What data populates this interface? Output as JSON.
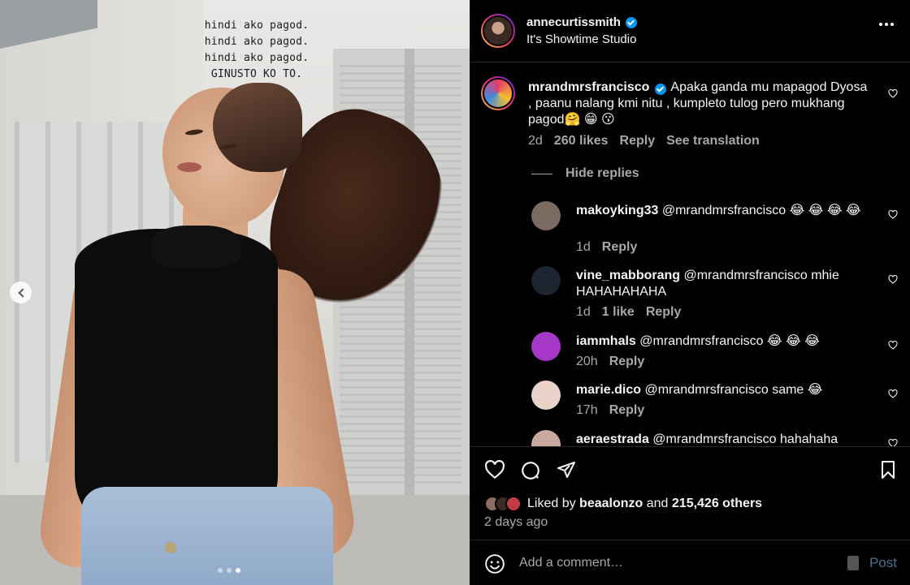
{
  "media": {
    "overlay_lines": [
      "hindi ako pagod.",
      "hindi ako pagod.",
      "hindi ako pagod.",
      "GINUSTO KO TO."
    ],
    "carousel": {
      "total": 3,
      "active": 3
    }
  },
  "header": {
    "username": "annecurtissmith",
    "location": "It's Showtime Studio",
    "verified": true
  },
  "main_comment": {
    "username": "mrandmrsfrancisco",
    "text": "Apaka ganda mu mapagod Dyosa , paanu nalang kmi nitu , kumpleto tulog pero mukhang pagod🤗 😁 😗",
    "time": "2d",
    "likes": "260 likes",
    "reply_label": "Reply",
    "translate_label": "See translation"
  },
  "hide_replies_label": "Hide replies",
  "replies": [
    {
      "username": "makoyking33",
      "text": "@mrandmrsfrancisco 😂 😂 😂 😂",
      "time": "1d",
      "likes": "",
      "reply_label": "Reply",
      "avatar_color": "#7a6a62"
    },
    {
      "username": "vine_mabborang",
      "text": "@mrandmrsfrancisco mhie HAHAHAHAHA",
      "time": "1d",
      "likes": "1 like",
      "reply_label": "Reply",
      "avatar_color": "#1c2430"
    },
    {
      "username": "iammhals",
      "text": "@mrandmrsfrancisco 😂 😂 😂",
      "time": "20h",
      "likes": "",
      "reply_label": "Reply",
      "avatar_color": "#a637c9"
    },
    {
      "username": "marie.dico",
      "text": "@mrandmrsfrancisco same 😂",
      "time": "17h",
      "likes": "",
      "reply_label": "Reply",
      "avatar_color": "#e9d3c9"
    },
    {
      "username": "aeraestrada",
      "text": "@mrandmrsfrancisco hahahaha",
      "time": "",
      "likes": "",
      "reply_label": "",
      "avatar_color": "#c8a9a0"
    }
  ],
  "likes_bar": {
    "liked_by_prefix": "Liked by",
    "liked_by_user": "beaalonzo",
    "and": "and",
    "others": "215,426 others",
    "posted": "2 days ago"
  },
  "add_comment": {
    "placeholder": "Add a comment…",
    "post_label": "Post"
  },
  "colors": {
    "accent": "#0095f6",
    "muted": "#a8a8a8",
    "background": "#000000"
  }
}
